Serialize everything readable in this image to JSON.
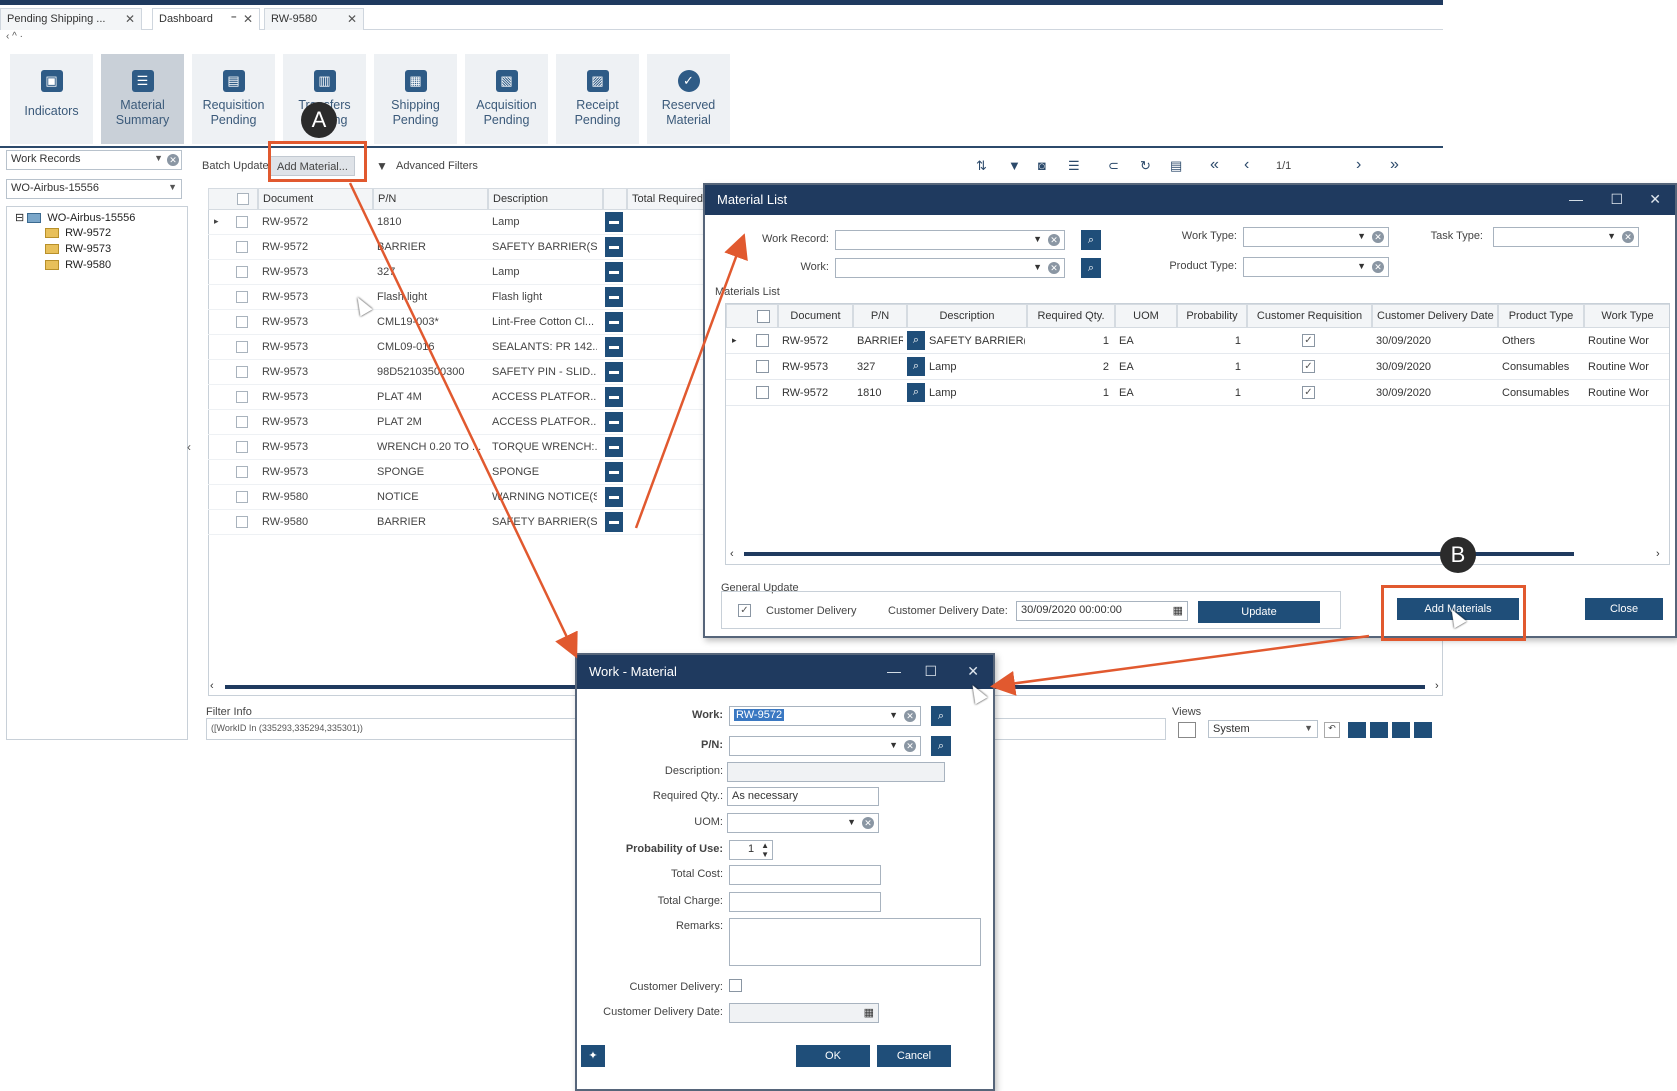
{
  "tabs": [
    {
      "label": "Pending Shipping ..."
    },
    {
      "label": "Dashboard"
    },
    {
      "label": "RW-9580"
    }
  ],
  "ribbon": [
    {
      "label": "Indicators"
    },
    {
      "label": "Material Summary"
    },
    {
      "label": "Requisition Pending"
    },
    {
      "label": "Transfers Pending"
    },
    {
      "label": "Shipping Pending"
    },
    {
      "label": "Acquisition Pending"
    },
    {
      "label": "Receipt Pending"
    },
    {
      "label": "Reserved Material"
    }
  ],
  "left_panel": {
    "records_combo": "Work Records",
    "work_combo": "WO-Airbus-15556",
    "tree_root": "WO-Airbus-15556",
    "tree_children": [
      "RW-9572",
      "RW-9573",
      "RW-9580"
    ]
  },
  "toolbar": {
    "batch_update": "Batch Update",
    "add_material": "Add Material...",
    "advanced_filters": "Advanced Filters",
    "pager": "1/1"
  },
  "grid": {
    "columns": [
      "Document",
      "P/N",
      "Description",
      "Total Required"
    ],
    "rows": [
      {
        "doc": "RW-9572",
        "pn": "1810",
        "desc": "Lamp"
      },
      {
        "doc": "RW-9572",
        "pn": "BARRIER",
        "desc": "SAFETY BARRIER(S)"
      },
      {
        "doc": "RW-9573",
        "pn": "327",
        "desc": "Lamp"
      },
      {
        "doc": "RW-9573",
        "pn": "Flash light",
        "desc": "Flash light"
      },
      {
        "doc": "RW-9573",
        "pn": "CML19-003*",
        "desc": "Lint-Free Cotton Cl..."
      },
      {
        "doc": "RW-9573",
        "pn": "CML09-016",
        "desc": "SEALANTS: PR 142..."
      },
      {
        "doc": "RW-9573",
        "pn": "98D52103500300",
        "desc": "SAFETY PIN - SLID..."
      },
      {
        "doc": "RW-9573",
        "pn": "PLAT 4M",
        "desc": "ACCESS PLATFOR..."
      },
      {
        "doc": "RW-9573",
        "pn": "PLAT 2M",
        "desc": "ACCESS PLATFOR..."
      },
      {
        "doc": "RW-9573",
        "pn": "WRENCH 0.20 TO ...",
        "desc": "TORQUE WRENCH:..."
      },
      {
        "doc": "RW-9573",
        "pn": "SPONGE",
        "desc": "SPONGE"
      },
      {
        "doc": "RW-9580",
        "pn": "NOTICE",
        "desc": "WARNING NOTICE(S)"
      },
      {
        "doc": "RW-9580",
        "pn": "BARRIER",
        "desc": "SAFETY BARRIER(S)"
      }
    ]
  },
  "filter_info": {
    "label": "Filter Info",
    "text": "([WorkID In (335293,335294,335301))"
  },
  "views": {
    "label": "Views",
    "value": "System"
  },
  "material_list": {
    "title": "Material List",
    "labels": {
      "work_record": "Work Record:",
      "work": "Work:",
      "work_type": "Work Type:",
      "product_type": "Product Type:",
      "task_type": "Task Type:",
      "materials_list": "Materials List"
    },
    "columns": [
      "Document",
      "P/N",
      "Description",
      "Required Qty.",
      "UOM",
      "Probability",
      "Customer Requisition",
      "Customer Delivery Date",
      "Product Type",
      "Work Type"
    ],
    "rows": [
      {
        "doc": "RW-9572",
        "pn": "BARRIER",
        "desc": "SAFETY BARRIER(S)",
        "qty": "1",
        "uom": "EA",
        "prob": "1",
        "date": "30/09/2020",
        "ptype": "Others",
        "wtype": "Routine Wor"
      },
      {
        "doc": "RW-9573",
        "pn": "327",
        "desc": "Lamp",
        "qty": "2",
        "uom": "EA",
        "prob": "1",
        "date": "30/09/2020",
        "ptype": "Consumables",
        "wtype": "Routine Wor"
      },
      {
        "doc": "RW-9572",
        "pn": "1810",
        "desc": "Lamp",
        "qty": "1",
        "uom": "EA",
        "prob": "1",
        "date": "30/09/2020",
        "ptype": "Consumables",
        "wtype": "Routine Wor"
      }
    ],
    "general_update": {
      "label": "General Update",
      "customer_delivery": "Customer Delivery",
      "date_label": "Customer Delivery Date:",
      "date_value": "30/09/2020 00:00:00",
      "update": "Update"
    },
    "add_materials": "Add Materials",
    "close": "Close"
  },
  "work_material": {
    "title": "Work - Material",
    "labels": {
      "work": "Work:",
      "pn": "P/N:",
      "description": "Description:",
      "required_qty": "Required Qty.:",
      "uom": "UOM:",
      "probability": "Probability of Use:",
      "total_cost": "Total Cost:",
      "total_charge": "Total Charge:",
      "remarks": "Remarks:",
      "customer_delivery": "Customer Delivery:",
      "customer_delivery_date": "Customer Delivery Date:"
    },
    "values": {
      "work": "RW-9572",
      "required_qty": "As necessary",
      "probability": "1"
    },
    "ok": "OK",
    "cancel": "Cancel"
  },
  "callouts": {
    "a": "A",
    "b": "B"
  },
  "colors": {
    "accent": "#1f4e79",
    "title_bar": "#1f3a5f",
    "callout": "#e1592f"
  }
}
